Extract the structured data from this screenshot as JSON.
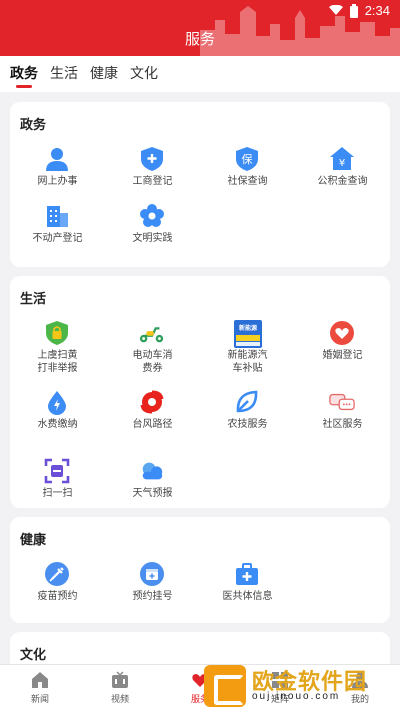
{
  "status": {
    "time": "2:34"
  },
  "header": {
    "title": "服务"
  },
  "tabs": [
    {
      "label": "政务",
      "active": true
    },
    {
      "label": "生活",
      "active": false
    },
    {
      "label": "健康",
      "active": false
    },
    {
      "label": "文化",
      "active": false
    }
  ],
  "sections": {
    "gov": {
      "title": "政务",
      "items": [
        {
          "label": "网上办事",
          "icon": "person-icon"
        },
        {
          "label": "工商登记",
          "icon": "shield-plus-icon"
        },
        {
          "label": "社保查询",
          "icon": "shield-bao-icon"
        },
        {
          "label": "公积金查询",
          "icon": "house-yen-icon"
        },
        {
          "label": "不动产登记",
          "icon": "building-icon"
        },
        {
          "label": "文明实践",
          "icon": "flower-icon"
        }
      ]
    },
    "life": {
      "title": "生活",
      "items": [
        {
          "label": "上虞扫黄\n打非举报",
          "icon": "lock-shield-icon"
        },
        {
          "label": "电动车消\n费券",
          "icon": "scooter-icon"
        },
        {
          "label": "新能源汽\n车补贴",
          "icon": "new-energy-poster-icon",
          "badge_text": "新能源"
        },
        {
          "label": "婚姻登记",
          "icon": "heart-icon"
        },
        {
          "label": "水费缴纳",
          "icon": "water-drop-icon"
        },
        {
          "label": "台风路径",
          "icon": "typhoon-icon"
        },
        {
          "label": "农技服务",
          "icon": "leaf-icon"
        },
        {
          "label": "社区服务",
          "icon": "chat-bubbles-icon"
        },
        {
          "label": "扫一扫",
          "icon": "scan-icon"
        },
        {
          "label": "天气预报",
          "icon": "cloud-icon"
        }
      ]
    },
    "health": {
      "title": "健康",
      "items": [
        {
          "label": "疫苗预约",
          "icon": "syringe-icon"
        },
        {
          "label": "预约挂号",
          "icon": "calendar-plus-icon"
        },
        {
          "label": "医共体信息",
          "icon": "medkit-icon"
        }
      ]
    },
    "culture": {
      "title": "文化"
    }
  },
  "bottom_nav": [
    {
      "label": "新闻",
      "icon": "home-icon",
      "active": false
    },
    {
      "label": "视频",
      "icon": "tv-icon",
      "active": false
    },
    {
      "label": "服务",
      "icon": "heart-nav-icon",
      "active": true
    },
    {
      "label": "矩阵",
      "icon": "grid-icon",
      "active": false
    },
    {
      "label": "我的",
      "icon": "user-icon",
      "active": false
    }
  ],
  "watermark": {
    "cn": "欧金软件园",
    "en": "ouj inouo.com"
  },
  "colors": {
    "brand": "#e1242a",
    "icon_blue": "#3c8cf5"
  }
}
